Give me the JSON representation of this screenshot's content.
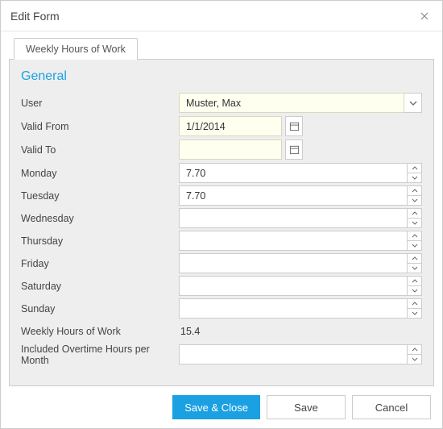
{
  "window": {
    "title": "Edit Form"
  },
  "tabs": {
    "main": "Weekly Hours of Work"
  },
  "section": {
    "title": "General"
  },
  "labels": {
    "user": "User",
    "valid_from": "Valid From",
    "valid_to": "Valid To",
    "monday": "Monday",
    "tuesday": "Tuesday",
    "wednesday": "Wednesday",
    "thursday": "Thursday",
    "friday": "Friday",
    "saturday": "Saturday",
    "sunday": "Sunday",
    "weekly_hours": "Weekly Hours of Work",
    "overtime": "Included Overtime Hours per Month"
  },
  "values": {
    "user": "Muster, Max",
    "valid_from": "1/1/2014",
    "valid_to": "",
    "monday": "7.70",
    "tuesday": "7.70",
    "wednesday": "",
    "thursday": "",
    "friday": "",
    "saturday": "",
    "sunday": "",
    "weekly_hours": "15.4",
    "overtime": ""
  },
  "buttons": {
    "save_close": "Save & Close",
    "save": "Save",
    "cancel": "Cancel"
  }
}
